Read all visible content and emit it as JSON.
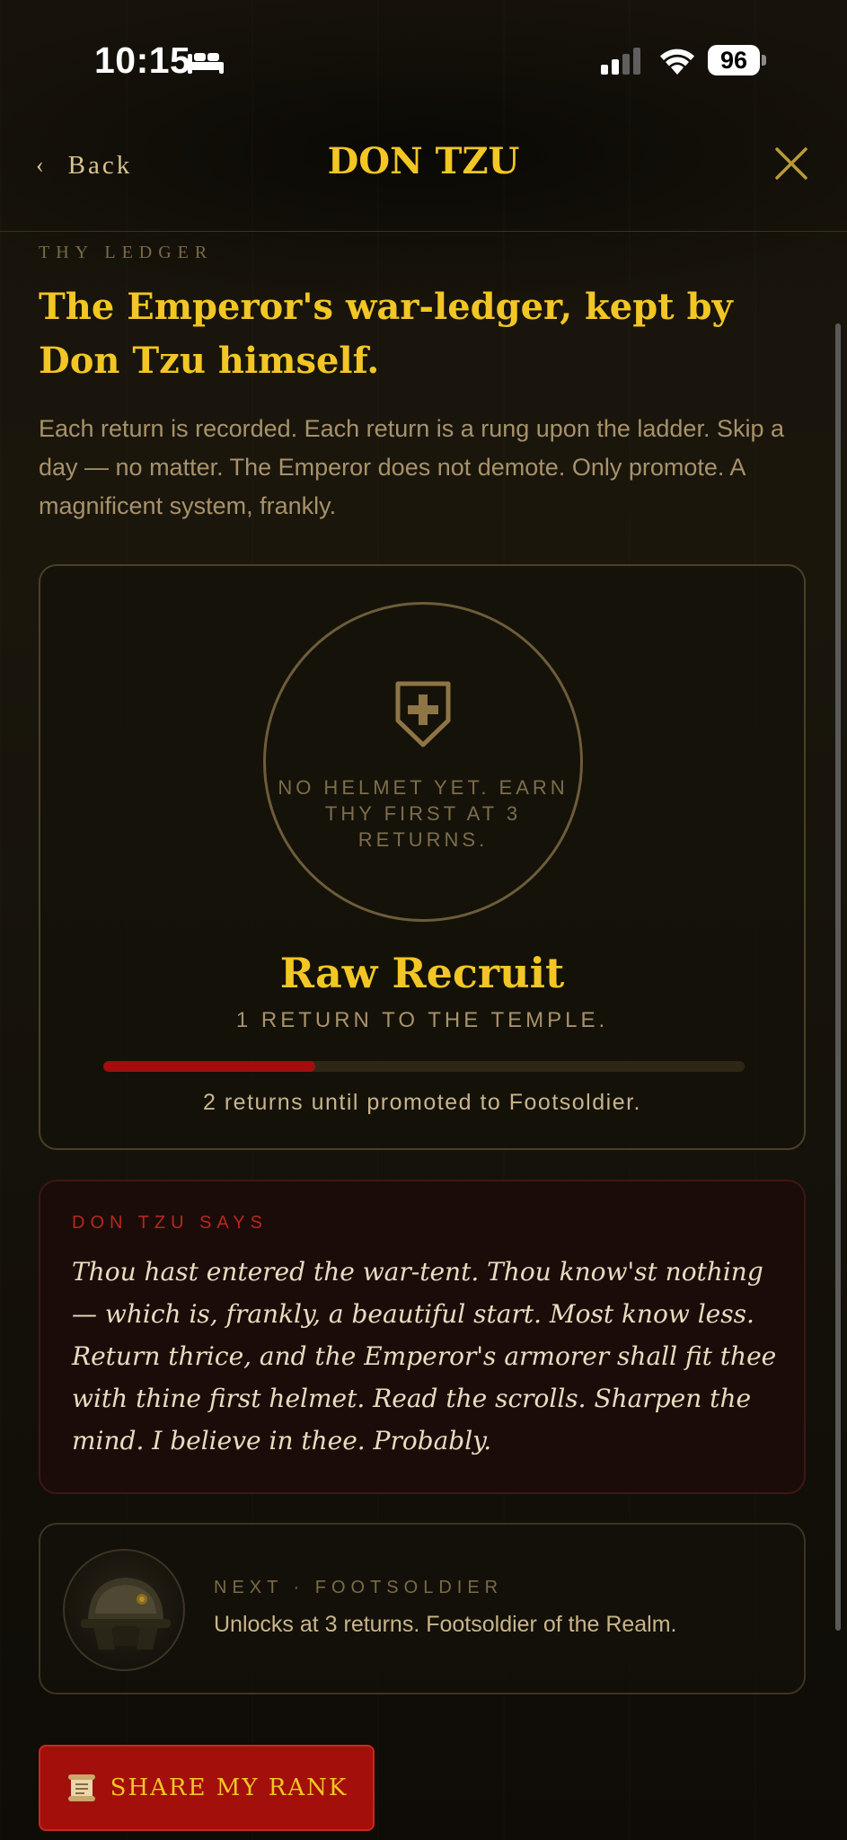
{
  "status_bar": {
    "time": "10:15",
    "battery": "96",
    "icons": [
      "bed-icon",
      "cellular-signal-icon",
      "wifi-icon",
      "battery-icon"
    ]
  },
  "nav": {
    "back_label": "Back",
    "title": "DON TZU",
    "back_icon": "chevron-left-icon",
    "close_icon": "close-icon"
  },
  "ledger": {
    "eyebrow": "THY LEDGER",
    "headline": "The Emperor's war-ledger, kept by Don Tzu himself.",
    "intro": "Each return is recorded. Each return is a rung upon the ladder. Skip a day — no matter. The Emperor does not demote. Only promote. A magnificent system, frankly."
  },
  "rank_card": {
    "helmet_icon": "shield-plus-icon",
    "helmet_note": "NO HELMET YET. EARN THY FIRST AT 3 RETURNS.",
    "rank_name": "Raw Recruit",
    "returns_label": "1 RETURN TO THE TEMPLE.",
    "progress": 0.33,
    "progress_note": "2 returns until promoted to Footsoldier."
  },
  "quote": {
    "eyebrow": "DON TZU SAYS",
    "text": "Thou hast entered the war-tent. Thou know'st nothing — which is, frankly, a beautiful start. Most know less. Return thrice, and the Emperor's armorer shall fit thee with thine first helmet. Read the scrolls. Sharpen the mind. I believe in thee. Probably."
  },
  "next_rank": {
    "eyebrow": "NEXT · FOOTSOLDIER",
    "text": "Unlocks at 3 returns. Footsoldier of the Realm.",
    "image": "footsoldier-helmet"
  },
  "share": {
    "icon": "scroll-icon",
    "label": "SHARE MY RANK"
  },
  "colors": {
    "gold": "#f2c624",
    "crimson": "#a30f0b",
    "background": "#120f08"
  }
}
